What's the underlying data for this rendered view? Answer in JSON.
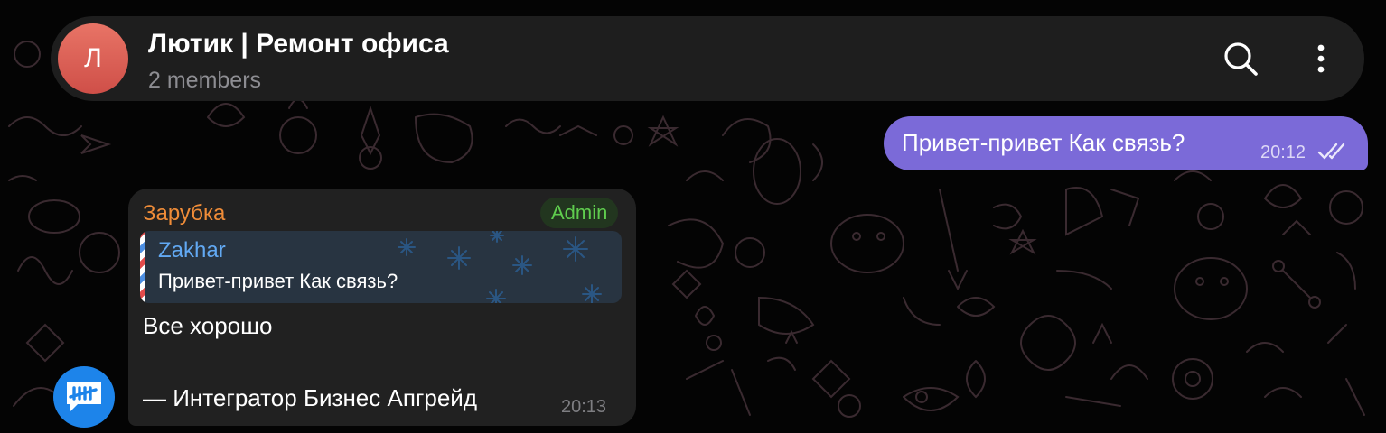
{
  "header": {
    "avatar_letter": "Л",
    "avatar_color": "#d9584f",
    "title": "Лютик | Ремонт офиса",
    "subtitle": "2 members",
    "search_icon": "search-icon",
    "more_icon": "more-vertical-icon"
  },
  "messages": {
    "outgoing": {
      "text": "Привет-привет Как связь?",
      "time": "20:12",
      "status_icon": "double-check-icon",
      "bubble_color": "#7b6ad8"
    },
    "incoming": {
      "sender_name": "Зарубка",
      "sender_color": "#ef8c38",
      "badge": "Admin",
      "reply": {
        "name": "Zakhar",
        "text": "Привет-привет Как связь?"
      },
      "line1": "Все хорошо",
      "line2": "— Интегратор Бизнес Апгрейд",
      "time": "20:13",
      "avatar_icon": "chat-logo-icon",
      "avatar_color": "#1d84ea"
    }
  },
  "colors": {
    "background": "#040404",
    "header_bg": "#1e1e1e",
    "incoming_bg": "#212121",
    "admin_green": "#5fcd4e",
    "reply_blue": "#62a9f3"
  }
}
